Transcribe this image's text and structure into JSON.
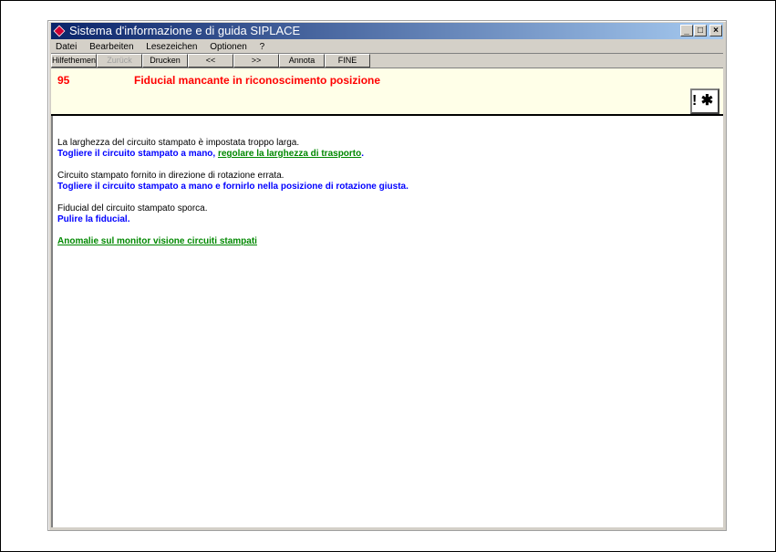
{
  "window": {
    "title": "Sistema d'informazione e di guida SIPLACE",
    "minimize": "_",
    "maximize": "□",
    "close": "×"
  },
  "menu": [
    "Datei",
    "Bearbeiten",
    "Lesezeichen",
    "Optionen",
    "?"
  ],
  "toolbar": [
    {
      "label": "Hilfethemen",
      "enabled": true
    },
    {
      "label": "Zurück",
      "enabled": false
    },
    {
      "label": "Drucken",
      "enabled": true
    },
    {
      "label": "<<",
      "enabled": true
    },
    {
      "label": ">>",
      "enabled": true
    },
    {
      "label": "Annota",
      "enabled": true
    },
    {
      "label": "FINE",
      "enabled": true
    }
  ],
  "header": {
    "number": "95",
    "title": "Fiducial mancante in riconoscimento posizione",
    "icon": "!"
  },
  "content": {
    "cause1": "La larghezza del circuito stampato è impostata troppo larga.",
    "action1a": "Togliere il circuito stampato a mano, ",
    "action1_link": "regolare la larghezza di trasporto",
    "action1b": ".",
    "cause2": "Circuito stampato fornito in direzione di rotazione errata.",
    "action2": "Togliere il circuito stampato a mano e fornirlo nella posizione di rotazione giusta.",
    "cause3": "Fiducial del circuito stampato sporca.",
    "action3": "Pulire la fiducial.",
    "link": "Anomalie sul monitor visione circuiti stampati"
  }
}
